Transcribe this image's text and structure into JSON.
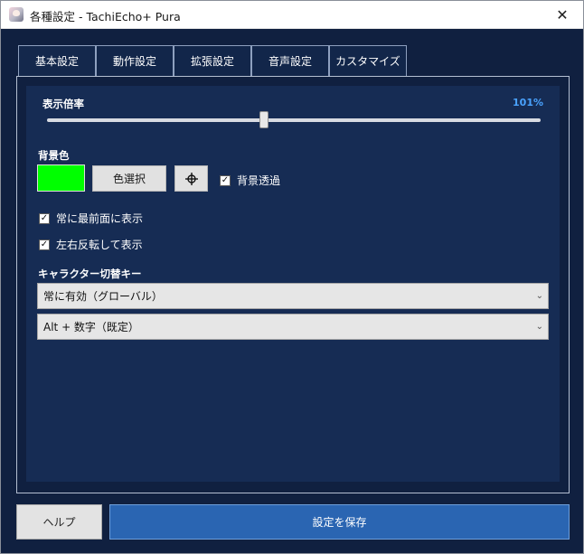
{
  "window": {
    "title": "各種設定 - TachiEcho+ Pura",
    "close_label": "✕"
  },
  "tabs": [
    {
      "label": "基本設定",
      "active": true
    },
    {
      "label": "動作設定",
      "active": false
    },
    {
      "label": "拡張設定",
      "active": false
    },
    {
      "label": "音声設定",
      "active": false
    },
    {
      "label": "カスタマイズ",
      "active": false
    }
  ],
  "display_scale": {
    "label": "表示倍率",
    "value_text": "101%",
    "slider_fraction": 0.44
  },
  "background": {
    "label": "背景色",
    "swatch_color": "#00ff00",
    "color_select_label": "色選択",
    "picker_icon": "crosshair-icon",
    "transparent_label": "背景透過",
    "transparent_checked": true
  },
  "options": {
    "always_on_top_label": "常に最前面に表示",
    "always_on_top_checked": true,
    "flip_label": "左右反転して表示",
    "flip_checked": true
  },
  "character_switch": {
    "label": "キャラクター切替キー",
    "mode_value": "常に有効（グローバル）",
    "key_value": "Alt + 数字（既定）"
  },
  "footer": {
    "help_label": "ヘルプ",
    "save_label": "設定を保存"
  },
  "colors": {
    "window_bg": "#102040",
    "panel_bg": "#162c54",
    "accent": "#4aa3ff",
    "save_button": "#2a65b2"
  }
}
